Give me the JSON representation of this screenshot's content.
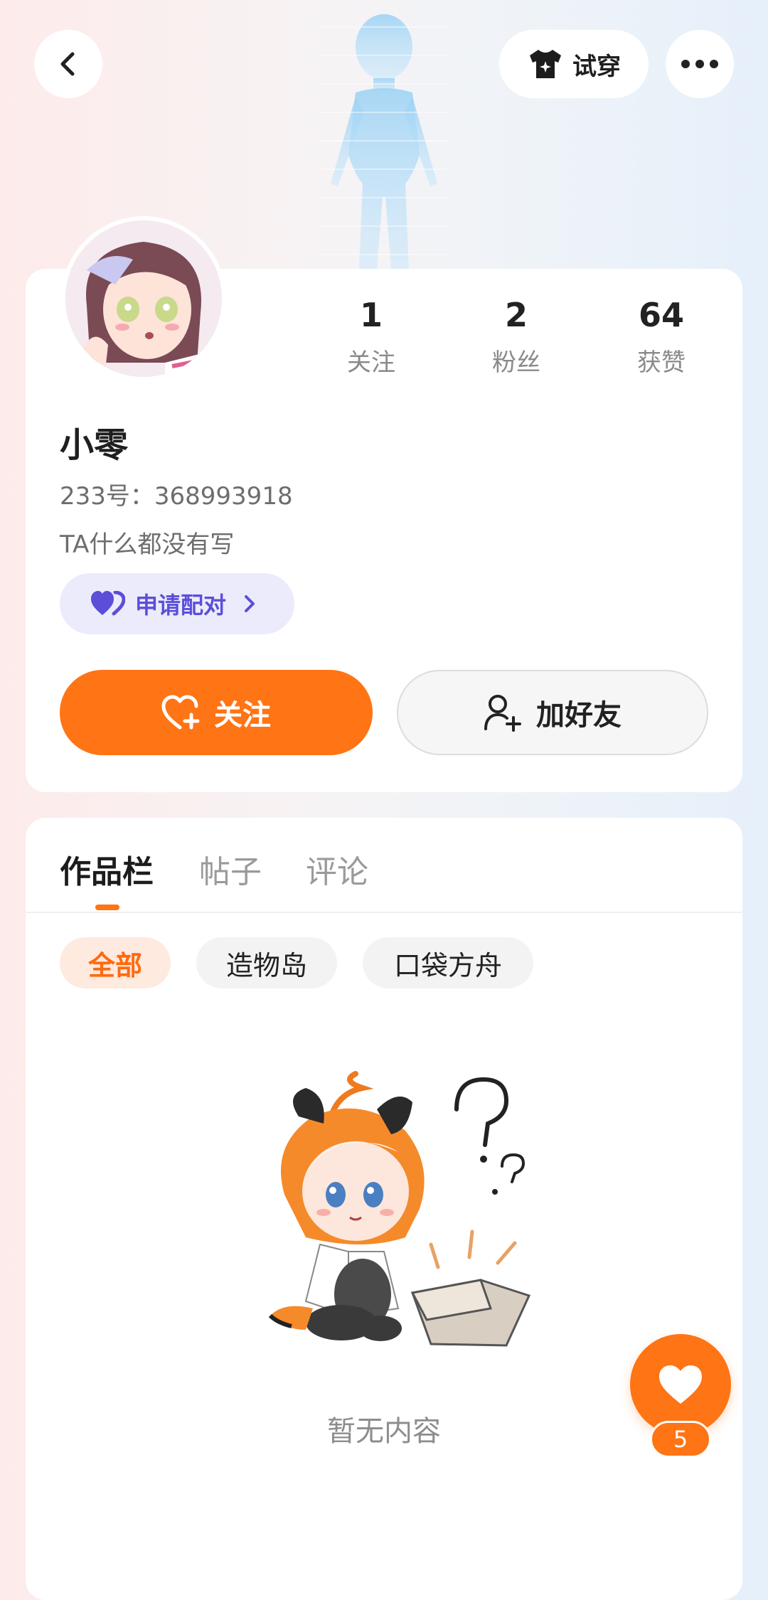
{
  "header": {
    "back_icon": "chevron-left-icon",
    "try_on_label": "试穿",
    "try_on_icon": "tshirt-sparkle-icon",
    "more_icon": "more-dots-icon"
  },
  "profile": {
    "stats": [
      {
        "value": "1",
        "label": "关注"
      },
      {
        "value": "2",
        "label": "粉丝"
      },
      {
        "value": "64",
        "label": "获赞"
      }
    ],
    "name": "小零",
    "uid": "233号：368993918",
    "bio": "TA什么都没有写",
    "pair_label": "申请配对",
    "follow_label": "关注",
    "add_friend_label": "加好友"
  },
  "content": {
    "tabs": [
      {
        "label": "作品栏",
        "active": true
      },
      {
        "label": "帖子",
        "active": false
      },
      {
        "label": "评论",
        "active": false
      }
    ],
    "chips": [
      {
        "label": "全部",
        "active": true
      },
      {
        "label": "造物岛",
        "active": false
      },
      {
        "label": "口袋方舟",
        "active": false
      }
    ],
    "empty_text": "暂无内容"
  },
  "fab": {
    "icon": "heart-icon",
    "count": "5"
  },
  "colors": {
    "accent": "#ff7414",
    "pair_purple": "#5b4fd8"
  }
}
